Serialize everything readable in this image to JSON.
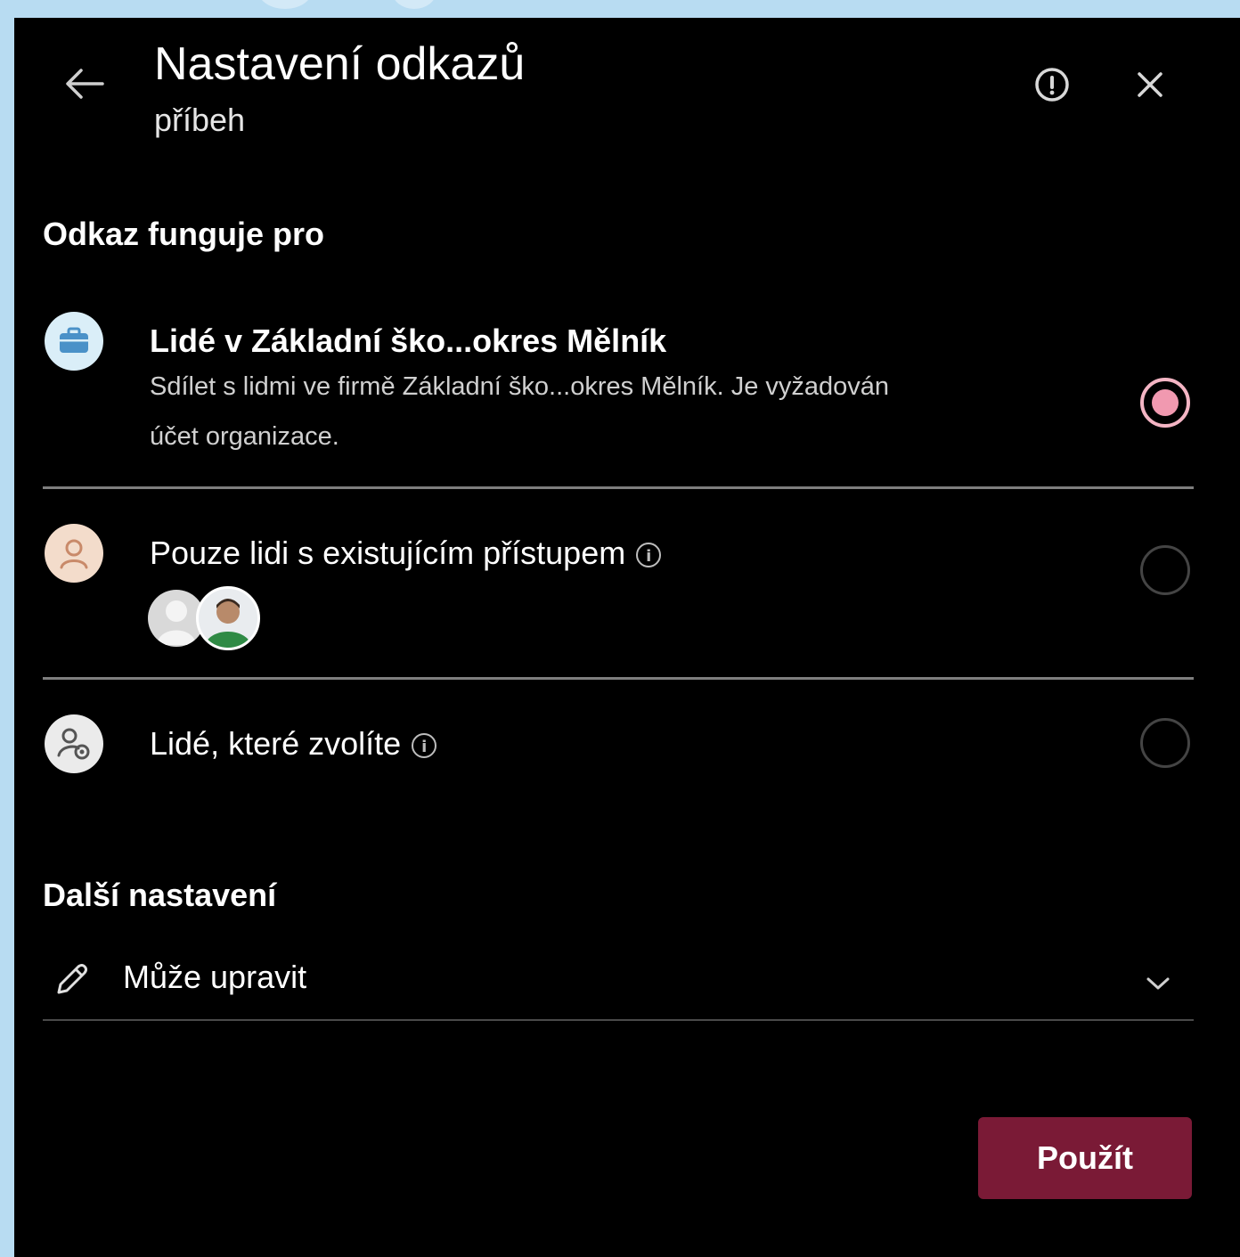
{
  "dialog": {
    "title": "Nastavení odkazů",
    "subtitle": "příbeh"
  },
  "link_works_for": {
    "heading": "Odkaz funguje pro",
    "options": [
      {
        "title": "Lidé v Základní ško...okres Mělník",
        "description": "Sdílet s lidmi ve firmě Základní ško...okres Mělník. Je vyžadován účet organizace.",
        "selected": true,
        "icon": "briefcase-icon"
      },
      {
        "title": "Pouze lidi s existujícím přístupem",
        "selected": false,
        "icon": "person-icon",
        "has_info": true
      },
      {
        "title": "Lidé, které zvolíte",
        "selected": false,
        "icon": "people-settings-icon",
        "has_info": true
      }
    ]
  },
  "more_settings": {
    "heading": "Další nastavení",
    "permission_value": "Může upravit"
  },
  "apply_label": "Použít",
  "colors": {
    "accent": "#7a1a36",
    "radio_selected": "#f199b0",
    "panel_bg": "#000000",
    "page_bg": "#b8dcf2"
  }
}
